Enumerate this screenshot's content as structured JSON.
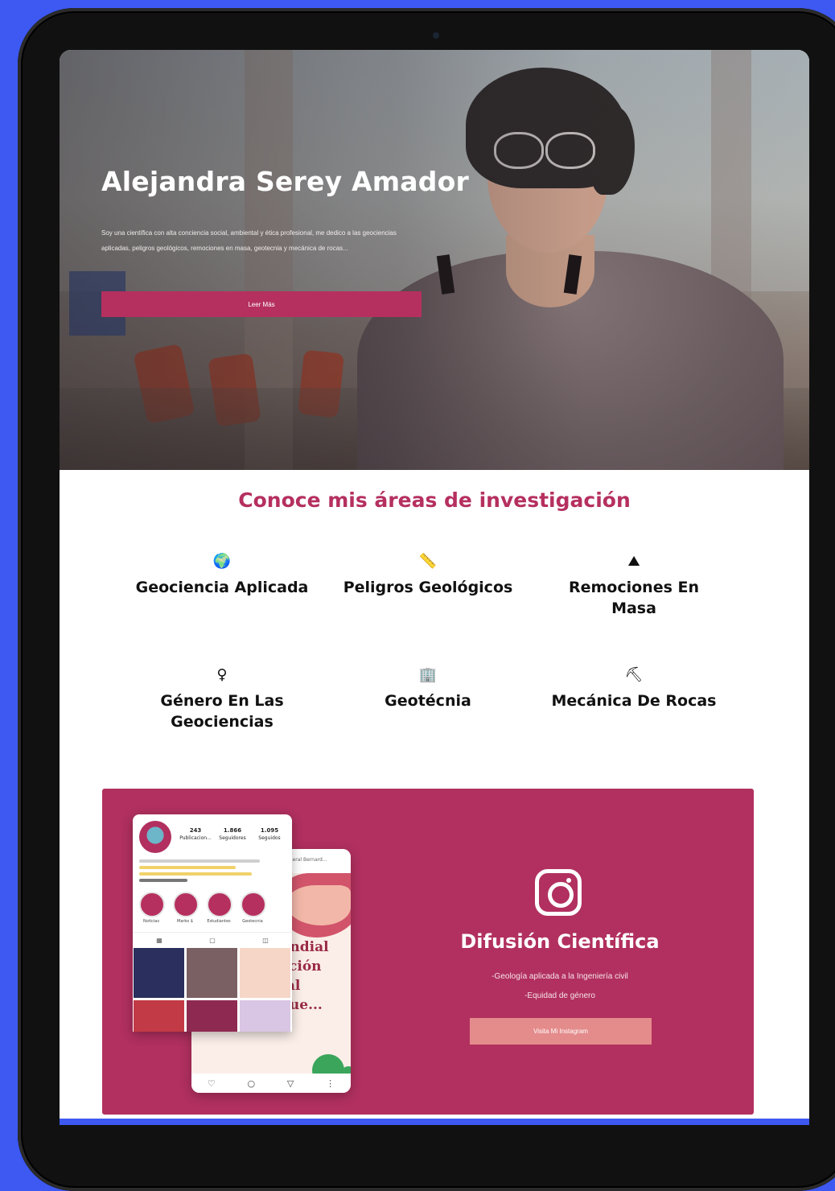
{
  "hero": {
    "name": "Alejandra Serey Amador",
    "description": "Soy una científica con alta conciencia social, ambiental y ética profesional, me dedico a las geociencias aplicadas, peligros geológicos, remociones en masa, geotecnia y mecánica de rocas...",
    "button_label": "Leer Más"
  },
  "research": {
    "title": "Conoce mis áreas de investigación",
    "areas": [
      {
        "label": "Geociencia Aplicada",
        "icon": "globe-icon",
        "glyph": "🌍"
      },
      {
        "label": "Peligros Geológicos",
        "icon": "ruler-icon",
        "glyph": "📏"
      },
      {
        "label": "Remociones En Masa",
        "icon": "landslide-icon",
        "glyph": "⛰"
      },
      {
        "label": "Género En Las Geociencias",
        "icon": "female-icon",
        "glyph": "♀"
      },
      {
        "label": "Geotécnia",
        "icon": "building-icon",
        "glyph": "🏢"
      },
      {
        "label": "Mecánica De Rocas",
        "icon": "rock-drill-icon",
        "glyph": "⛏"
      }
    ]
  },
  "instagram": {
    "title": "Difusión Científica",
    "lines": [
      "-Geología aplicada a la Ingeniería civil",
      "-Equidad de género"
    ],
    "button_label": "Visita Mi Instagram",
    "profile": {
      "stats": [
        {
          "value": "243",
          "label": "Publicacion..."
        },
        {
          "value": "1.866",
          "label": "Seguidores"
        },
        {
          "value": "1.095",
          "label": "Seguidos"
        }
      ],
      "highlights": [
        "Noticias",
        "Marko $",
        "Estudiantes",
        "Geotecnia"
      ],
      "back_header": "Cuenta General Bernard...",
      "back_text": [
        "undial",
        "ación",
        "tal",
        "que..."
      ]
    }
  },
  "colors": {
    "background": "#3d59f2",
    "accent": "#b5305f",
    "ig_card": "#b1305f",
    "ig_button": "#e48b8b"
  }
}
